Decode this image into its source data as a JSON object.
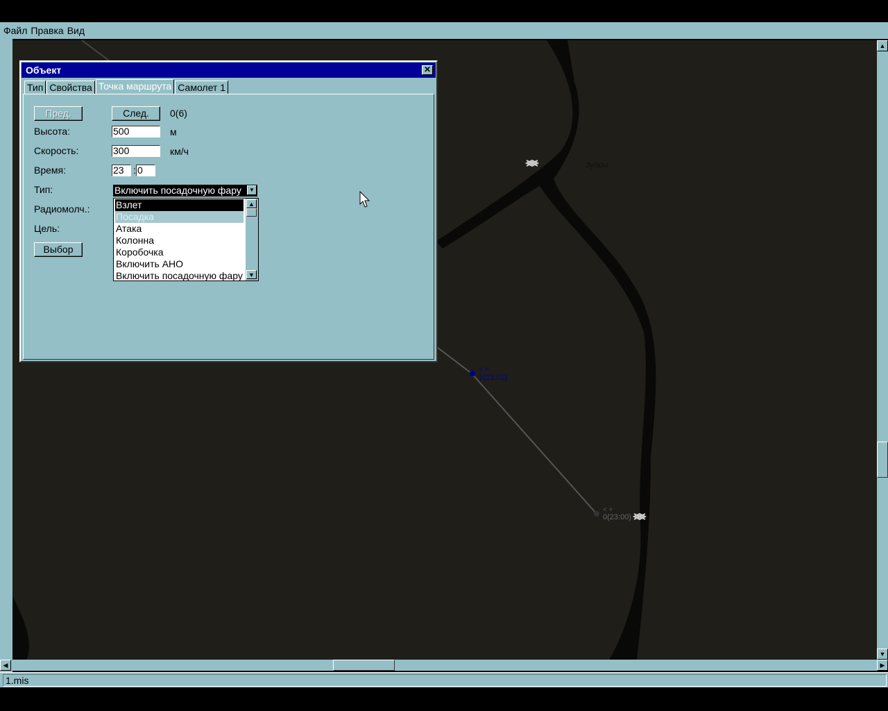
{
  "menu": [
    "Файл",
    "Правка",
    "Вид"
  ],
  "status": "1.mis",
  "dialog": {
    "title": "Объект",
    "tabs": [
      "Тип",
      "Свойства",
      "Точка маршрута",
      "Самолет 1"
    ],
    "active_tab": 2,
    "prev": "Пред.",
    "next": "След.",
    "counter": "0(6)",
    "altitude_label": "Высота:",
    "altitude": "500",
    "altitude_unit": "м",
    "speed_label": "Скорость:",
    "speed": "300",
    "speed_unit": "км/ч",
    "time_label": "Время:",
    "time_h": "23",
    "time_sep": ":",
    "time_m": "0",
    "type_label": "Тип:",
    "type_value": "Включить посадочную фару",
    "radio_label": "Радиомолч.:",
    "target_label": "Цель:",
    "select": "Выбор",
    "options": [
      "Взлет",
      "Посадка",
      "Атака",
      "Колонна",
      "Коробочка",
      "Включить АНО",
      "Включить посадочную фару"
    ]
  },
  "map": {
    "town": "Зубры",
    "wp1_sym": "< +",
    "wp1": "1(23:01)",
    "wp0_sym": "< +",
    "wp0": "0(23:00)"
  }
}
